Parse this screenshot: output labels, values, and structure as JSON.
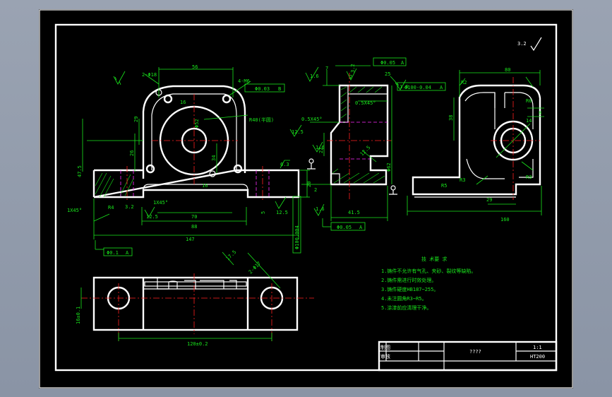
{
  "colors": {
    "bg": "#000000",
    "outline": "#ffffff",
    "dim": "#19e61c",
    "center": "#ff2020",
    "hidden": "#ff2dff"
  },
  "front_view": {
    "dims": [
      "56",
      "2-Φ18",
      "4-M6",
      "Φ0.03",
      "B",
      "R40(半圆)",
      "Φ52",
      "29",
      "26",
      "47.5",
      "16",
      "16",
      "34",
      "70",
      "88",
      "147",
      "1X45°",
      "R4",
      "3.2",
      "12.5",
      "12.5",
      "6.3",
      "20",
      "5",
      "1X45°",
      "Φ0.1",
      "A"
    ]
  },
  "side_section": {
    "dims": [
      "7",
      "Φ0.05",
      "A",
      "2",
      "1.6",
      "25",
      "3.2",
      "1.6",
      "Φ100-0.04",
      "A",
      "0.5X45°",
      "0.5X45°",
      "12.5",
      "22",
      "1.6",
      "Φ62",
      "2",
      "41.5",
      "1.6",
      "Φ0.05",
      "A",
      "Φ100.004"
    ]
  },
  "right_view": {
    "dims": [
      "80",
      "R2",
      "38",
      "R6",
      "8",
      "14",
      "R3",
      "R5",
      "29",
      "160"
    ]
  },
  "bottom_view": {
    "dims": [
      "17.5",
      "2-Φ17",
      "120±0.2",
      "16±0.1"
    ]
  },
  "tech_requirements": {
    "title": "技 术要 求",
    "lines": [
      "1.铸件不允许有气孔、夹砂、裂纹等缺陷。",
      "2.铸件需进行时效处理。",
      "3.铸件硬度HB187~255。",
      "4.未注圆角R3~R5。",
      "5.涂漆前应清理干净。"
    ]
  },
  "title_block": {
    "name": "????",
    "scale": "1:1",
    "material": "HT200",
    "row1": "制图",
    "row2": "审核"
  },
  "corner_mark": "3.2"
}
